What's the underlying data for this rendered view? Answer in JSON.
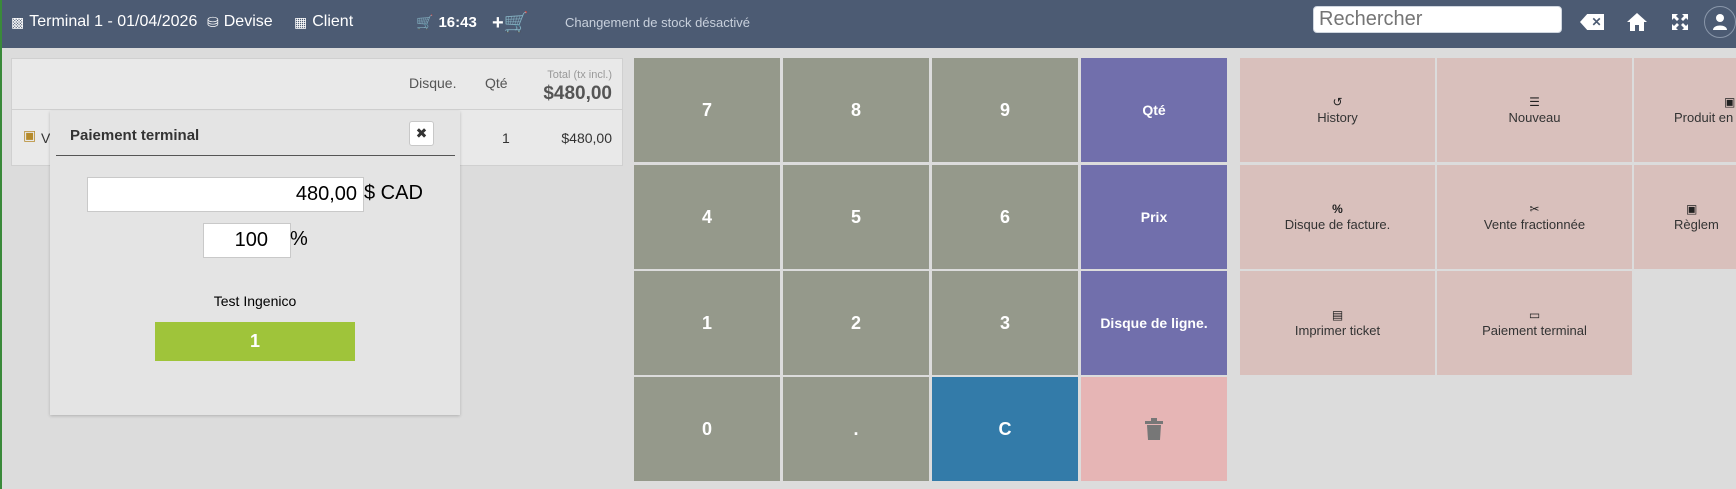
{
  "topbar": {
    "terminal": "Terminal 1 - 01/04/2026",
    "currency": "Devise",
    "client": "Client",
    "clock": "16:43",
    "stock_notice": "Changement de stock désactivé",
    "search_placeholder": "Rechercher"
  },
  "order": {
    "headers": {
      "discount": "Disque.",
      "qty": "Qté",
      "total_label": "Total (tx incl.)",
      "total_value": "$480,00"
    },
    "lines": [
      {
        "label": "V",
        "qty": "1",
        "amount": "$480,00"
      }
    ]
  },
  "dialog": {
    "title": "Paiement terminal",
    "amount": "480,00",
    "currency_unit": "$ CAD",
    "percent": "100",
    "percent_unit": "%",
    "terminal_name": "Test Ingenico",
    "terminal_button": "1"
  },
  "keypad": {
    "row1": [
      "7",
      "8",
      "9"
    ],
    "row2": [
      "4",
      "5",
      "6"
    ],
    "row3": [
      "1",
      "2",
      "3"
    ],
    "row4": [
      "0",
      "."
    ],
    "clear": "C",
    "qty": "Qté",
    "price": "Prix",
    "line_discount": "Disque de ligne."
  },
  "actions": {
    "history": "History",
    "new": "Nouveau",
    "product": "Produit en t",
    "invoice_discount": "Disque de facture.",
    "split_sale": "Vente fractionnée",
    "settle": "Règlem",
    "print_ticket": "Imprimer ticket",
    "terminal_payment": "Paiement terminal"
  },
  "colors": {
    "topbar": "#4c5b73",
    "numkey": "#95998b",
    "actionkey": "#716fac",
    "clearkey": "#337ba9",
    "deletekey": "#e6b5b5",
    "tile": "#d9c0bc",
    "terminal_button": "#9fc43a"
  }
}
